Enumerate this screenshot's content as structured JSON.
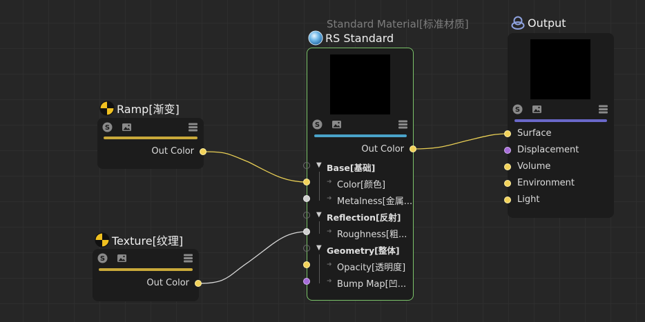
{
  "nodes": {
    "ramp": {
      "title": "Ramp[渐变]",
      "out_port": "Out Color",
      "accent_color": "#c9a93a"
    },
    "texture": {
      "title": "Texture[纹理]",
      "out_port": "Out Color",
      "accent_color": "#c9a93a"
    },
    "rs_standard": {
      "subtitle": "Standard Material[标准材质]",
      "title": "RS Standard",
      "out_port": "Out Color",
      "accent_color": "#4aa3c9",
      "border_color": "#7cc46a",
      "groups": {
        "base": "Base[基础]",
        "reflection": "Reflection[反射]",
        "geometry": "Geometry[整体]"
      },
      "inputs": {
        "color": "Color[颜色]",
        "metalness": "Metalness[金属...",
        "roughness": "Roughness[粗...",
        "opacity": "Opacity[透明度]",
        "bump_map": "Bump Map[凹..."
      }
    },
    "output": {
      "title": "Output",
      "accent_color": "#6a68c9",
      "inputs": [
        "Surface",
        "Displacement",
        "Volume",
        "Environment",
        "Light"
      ]
    }
  },
  "colors": {
    "port_yellow": "#f2d25a",
    "port_purple": "#a66cd8",
    "wire_yellow": "#e9cf55",
    "wire_white": "#d8d8d8",
    "background": "#262626"
  }
}
